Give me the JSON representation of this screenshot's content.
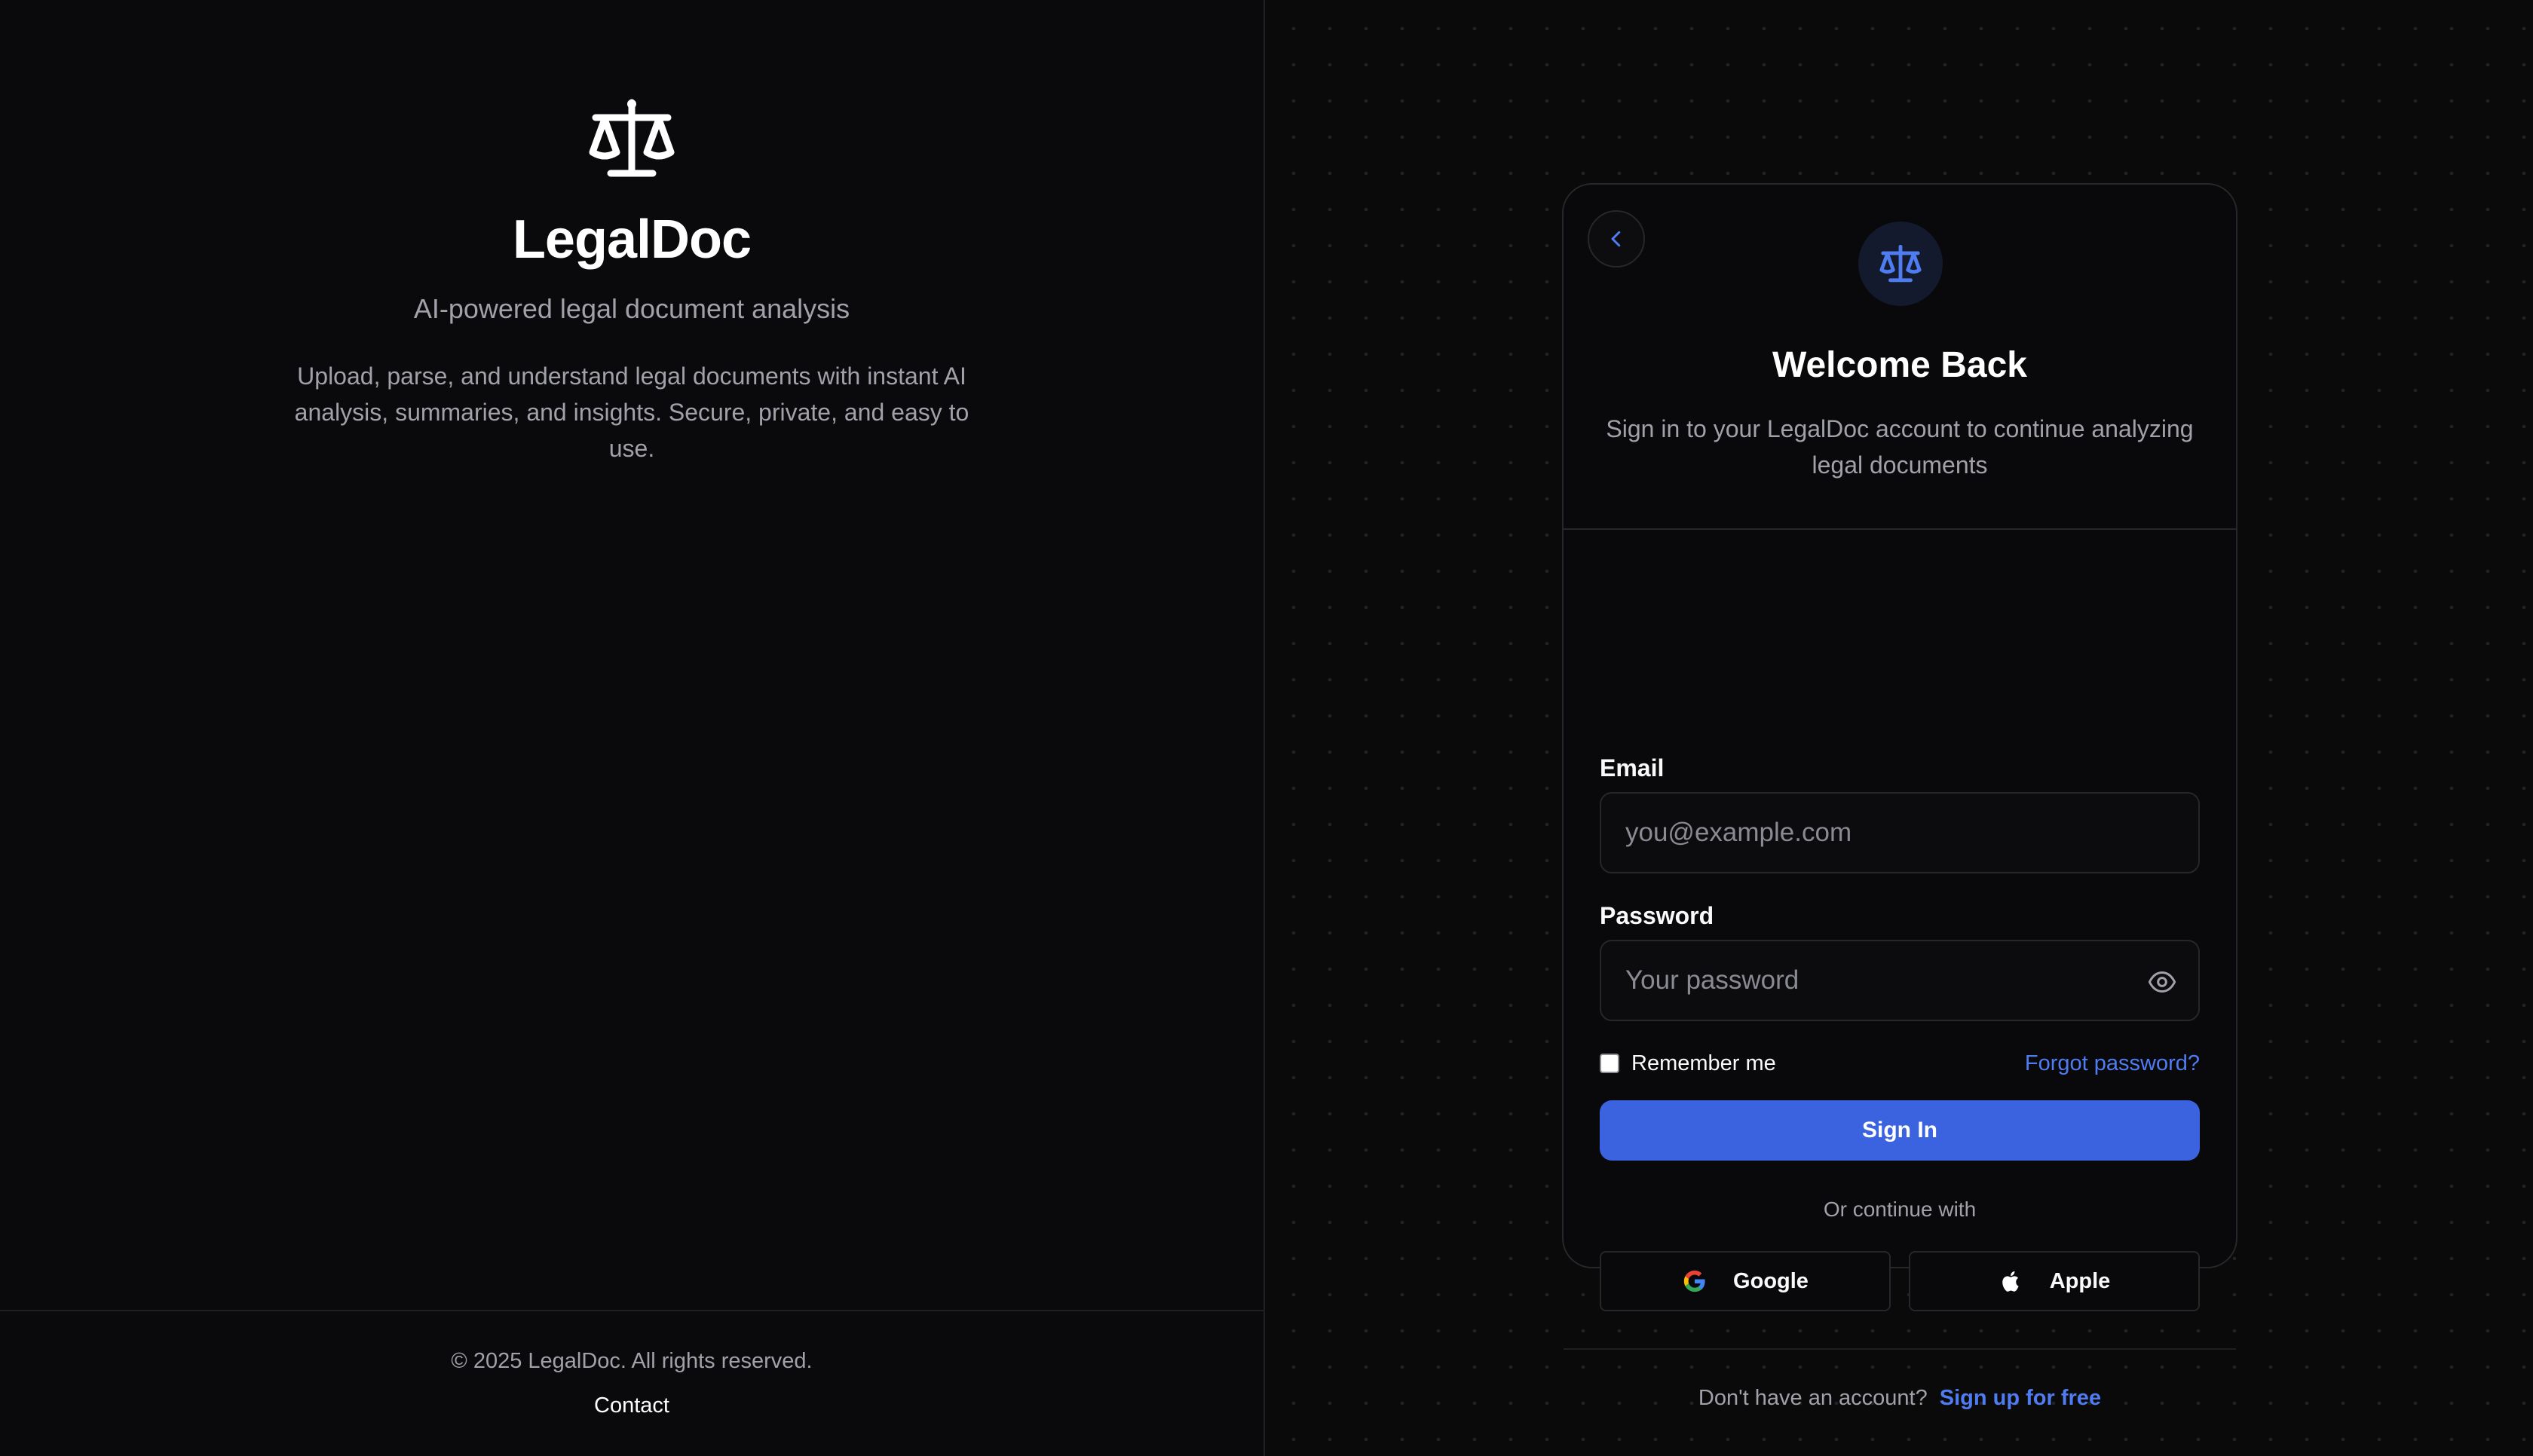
{
  "brand": {
    "name": "LegalDoc",
    "tagline": "AI-powered legal document analysis",
    "description": "Upload, parse, and understand legal documents with instant AI analysis, summaries, and insights. Secure, private, and easy to use.",
    "logo_icon": "scale-icon"
  },
  "footer": {
    "copyright": "© 2025 LegalDoc. All rights reserved.",
    "contact_label": "Contact"
  },
  "login_card": {
    "back_icon": "chevron-left-icon",
    "logo_icon": "scale-icon",
    "title": "Welcome Back",
    "subtitle": "Sign in to your LegalDoc account to continue analyzing legal documents",
    "email_label": "Email",
    "email_value": "",
    "email_placeholder": "you@example.com",
    "password_label": "Password",
    "password_value": "",
    "password_placeholder": "Your password",
    "password_toggle_icon": "eye-icon",
    "remember_label": "Remember me",
    "remember_checked": false,
    "forgot_label": "Forgot password?",
    "signin_label": "Sign In",
    "or_text": "Or continue with",
    "google_label": "Google",
    "apple_label": "Apple",
    "no_account_text": "Don't have an account?",
    "signup_label": "Sign up for free"
  },
  "colors": {
    "background": "#09090b",
    "accent": "#3b63e0",
    "link": "#4f7cf0",
    "muted_text": "#a1a1aa",
    "border": "#27272a"
  }
}
